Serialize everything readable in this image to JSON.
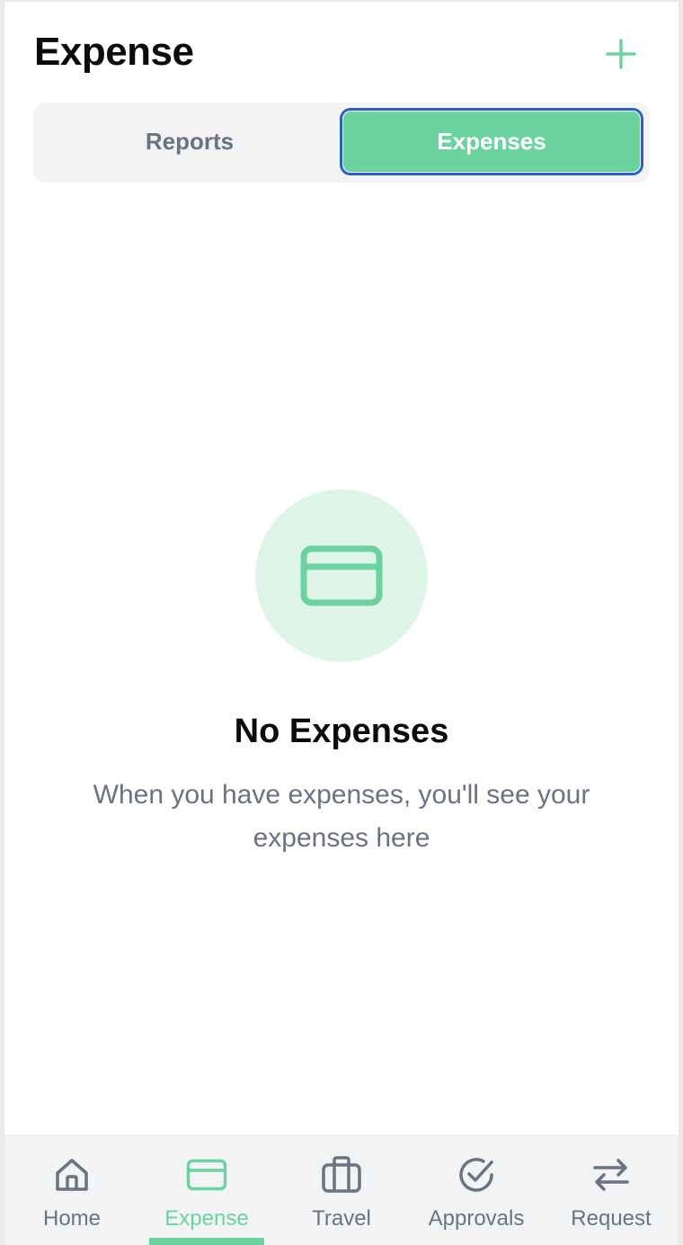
{
  "header": {
    "title": "Expense"
  },
  "tabs": [
    {
      "label": "Reports",
      "active": false
    },
    {
      "label": "Expenses",
      "active": true
    }
  ],
  "empty_state": {
    "icon": "credit-card-icon",
    "title": "No Expenses",
    "description": "When you have expenses, you'll see your expenses here"
  },
  "bottom_nav": [
    {
      "label": "Home",
      "icon": "home-icon",
      "active": false
    },
    {
      "label": "Expense",
      "icon": "credit-card-icon",
      "active": true
    },
    {
      "label": "Travel",
      "icon": "briefcase-icon",
      "active": false
    },
    {
      "label": "Approvals",
      "icon": "check-circle-icon",
      "active": false
    },
    {
      "label": "Request",
      "icon": "arrows-swap-icon",
      "active": false
    }
  ],
  "colors": {
    "accent": "#6bd39f",
    "accent_light": "#e0f5e9",
    "muted_text": "#6b7280",
    "focus_ring": "#2f5fc2"
  }
}
